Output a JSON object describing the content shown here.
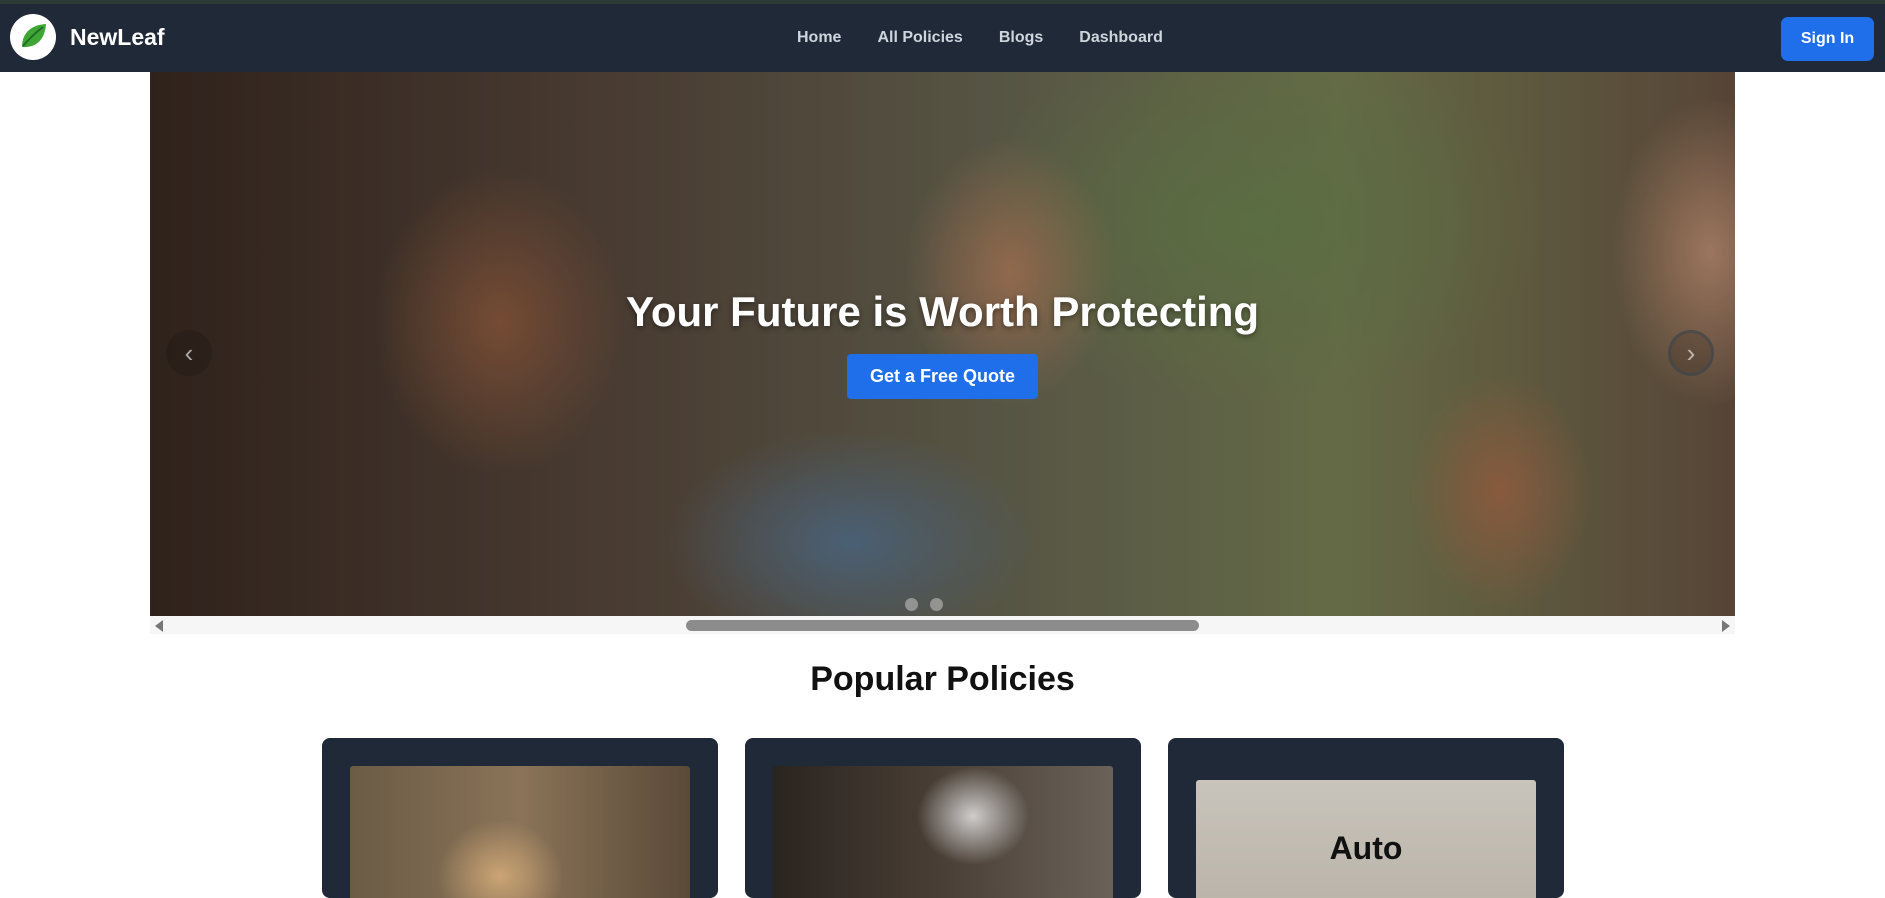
{
  "brand": {
    "name": "NewLeaf",
    "logo_icon": "leaf-icon",
    "logo_color": "#3fa535"
  },
  "nav": {
    "links": [
      "Home",
      "All Policies",
      "Blogs",
      "Dashboard"
    ]
  },
  "header": {
    "signin_label": "Sign In"
  },
  "hero": {
    "title": "Your Future is Worth Protecting",
    "cta_label": "Get a Free Quote",
    "prev_icon": "chevron-left-icon",
    "next_icon": "chevron-right-icon",
    "slide_count": 2,
    "active_slide": 1
  },
  "section": {
    "title": "Popular Policies"
  },
  "cards": [
    {
      "image": "family-photo"
    },
    {
      "image": "senior-woman-photo"
    },
    {
      "label": "Auto"
    }
  ],
  "colors": {
    "navbar": "#1f2937",
    "primary": "#1f6feb",
    "card_bg": "#1f2937"
  }
}
